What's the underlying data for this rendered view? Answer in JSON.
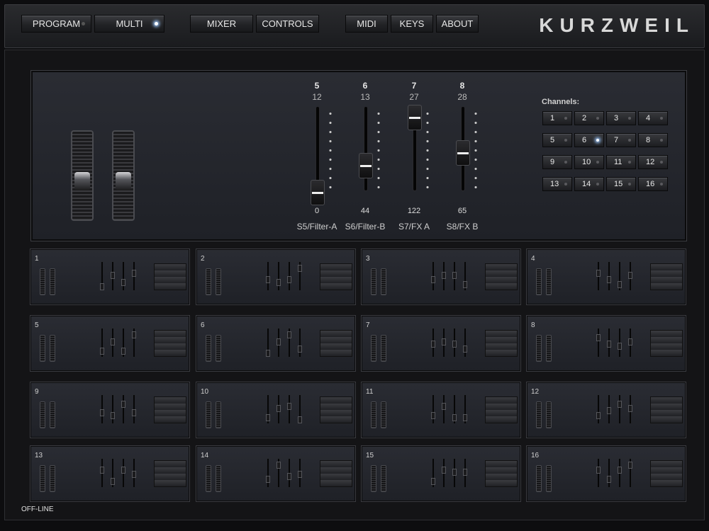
{
  "nav": {
    "program": "PROGRAM",
    "multi": "MULTI",
    "mixer": "MIXER",
    "controls": "CONTROLS",
    "midi": "MIDI",
    "keys": "KEYS",
    "about": "ABOUT"
  },
  "brand": "KURZWEIL",
  "main_panel": {
    "sliders": [
      {
        "number": "5",
        "cc": "12",
        "value": "0",
        "name": "S5/Filter-A",
        "level": 0.0
      },
      {
        "number": "6",
        "cc": "13",
        "value": "44",
        "name": "S6/Filter-B",
        "level": 0.35
      },
      {
        "number": "7",
        "cc": "27",
        "value": "122",
        "name": "S7/FX A",
        "level": 0.96
      },
      {
        "number": "8",
        "cc": "28",
        "value": "65",
        "name": "S8/FX B",
        "level": 0.51
      }
    ],
    "channels_label": "Channels:",
    "channels": [
      "1",
      "2",
      "3",
      "4",
      "5",
      "6",
      "7",
      "8",
      "9",
      "10",
      "11",
      "12",
      "13",
      "14",
      "15",
      "16"
    ],
    "active_channel": "6"
  },
  "multi_slots": [
    "1",
    "2",
    "3",
    "4",
    "5",
    "6",
    "7",
    "8",
    "9",
    "10",
    "11",
    "12",
    "13",
    "14",
    "15",
    "16"
  ],
  "status": "OFF-LINE"
}
